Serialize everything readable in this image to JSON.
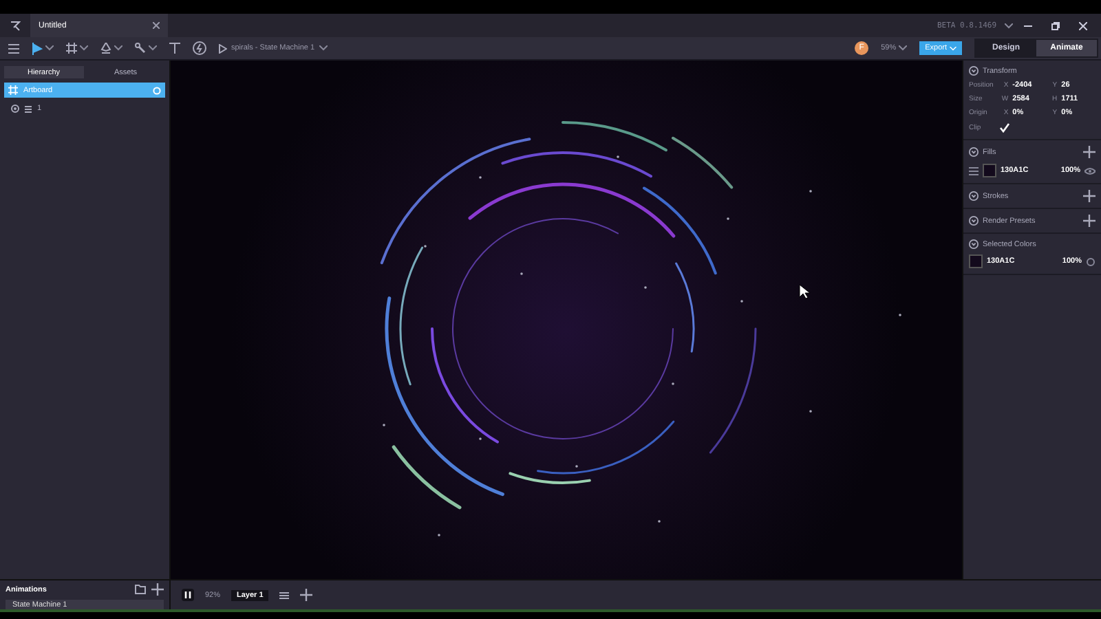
{
  "window": {
    "tab_title": "Untitled",
    "version": "BETA 0.8.1469"
  },
  "toolbar": {
    "scene": "spirals - State Machine 1",
    "avatar": "F",
    "zoom": "59%",
    "export": "Export",
    "modes": [
      {
        "label": "Design",
        "selected": false
      },
      {
        "label": "Animate",
        "selected": true
      }
    ]
  },
  "left_panel": {
    "tabs": [
      {
        "label": "Hierarchy",
        "selected": true
      },
      {
        "label": "Assets",
        "selected": false
      }
    ],
    "artboard": {
      "label": "Artboard",
      "selected": true
    },
    "children": [
      {
        "label": "1"
      }
    ]
  },
  "inspector": {
    "transform": {
      "title": "Transform",
      "rows": [
        {
          "label": "Position",
          "a_label": "X",
          "a": "-2404",
          "b_label": "Y",
          "b": "26"
        },
        {
          "label": "Size",
          "a_label": "W",
          "a": "2584",
          "b_label": "H",
          "b": "1711"
        },
        {
          "label": "Origin",
          "a_label": "X",
          "a": "0%",
          "b_label": "Y",
          "b": "0%"
        }
      ],
      "clip_label": "Clip",
      "clip": true
    },
    "fills": {
      "title": "Fills",
      "color": "#130a1c",
      "hex": "130A1C",
      "opacity": "100%"
    },
    "sections": [
      "Strokes",
      "Render Presets"
    ],
    "selected_colors": {
      "title": "Selected Colors",
      "color": "#130a1c",
      "hex": "130A1C",
      "opacity": "100%"
    }
  },
  "bottom": {
    "animations_title": "Animations",
    "state_machine": "State Machine 1",
    "timeline_zoom": "92%",
    "layer": "Layer 1"
  }
}
